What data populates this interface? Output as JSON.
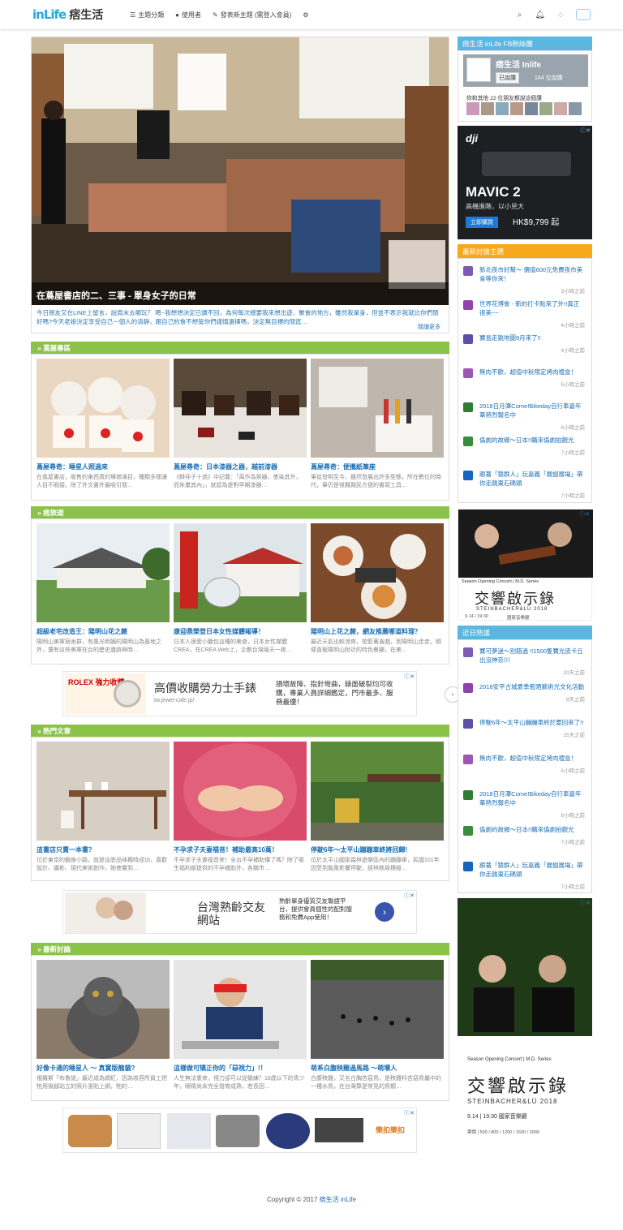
{
  "nav": {
    "logo_mark": "inLife",
    "logo_text": "痞生活",
    "items": [
      "主題分類",
      "使用者",
      "發表新主題 (需登入會員)"
    ]
  },
  "hero": {
    "caption": "在蔦屋書店的二、三事 - 單身女子的日常",
    "excerpt": "今日朋友又在LINE上留言，說周末去哪玩？ 嗯~我想想決定已讀不回，為何每次總要我來想出遊、聚會的地方，雖然我單身，但並不表示我就比你們閒好嗎?今天老娘決定享受自己一個人的清靜，跟自己約會不想管你們謹慎選擇嗎，決定無目標的閒逛…",
    "more": "閱讀更多"
  },
  "sections": [
    {
      "title": "蔦屋專區",
      "cards": [
        {
          "title": "蔦屋尋奇：睡星人照過來",
          "desc": "在蔦屋書店，販售的東西真的琳瑯滿目，種類多樣讓人目不暇接，除了外文書外最吸引我…"
        },
        {
          "title": "蔦屋尋奇：日本漆器之器，越前漆器",
          "desc": "《韓非子十過》中記載：「禹作為祭器，墨染其外，而朱畫其內」，就認為是對早期漆器…"
        },
        {
          "title": "蔦屋尋奇：便攜紙筆座",
          "desc": "筆從發明至今，雖然發展出許多型態，所在數位的時代，筆仍是很難親民方便的書寫工具…"
        }
      ]
    },
    {
      "title": "痞旅遊",
      "cards": [
        {
          "title": "超級老宅改造王：陽明山花之蕨",
          "desc": "陽明山美軍宿舍群，有風光明媚的陽明山為基地之外，還有這些美軍在台的歷史遺跡與時…"
        },
        {
          "title": "康迎鼎榮登日本女性媒體報導！",
          "desc": "日本人很愛小籠包這種的美食，日本女性媒體CREA，在CREA Web上，企劃台灣兩天一夜…"
        },
        {
          "title": "陽明山上花之蕨，網友推薦哪道料理？",
          "desc": "最近天氣出較涼爽，想藍著貪戲，到陽明山走走，順便直衝陽明山附近的特色餐廳，在美…"
        }
      ]
    },
    {
      "title": "熱門文章",
      "cards": [
        {
          "title": "這書店只賣一本書？",
          "desc": "位於東京的銀座小路，就是這麼品味獨特成功，喜歡設計、攝影、現代美術創作，她會嘗到…"
        },
        {
          "title": "不孕求子夫妻福音！補助最高10萬！",
          "desc": "不孕求子夫妻福音來！全台不孕補助懂了嗎？除了衛生福利部提供的不孕補助外，各縣市…"
        },
        {
          "title": "停駛6年～太平山蹦蹦車終將回歸!",
          "desc": "位於太平山國家森林遊樂區內的蹦蹦車，民國101年因受到颱風影響停駛，經林務局積極…"
        }
      ]
    },
    {
      "title": "最新討論",
      "cards": [
        {
          "title": "好像卡通的睡星人 ～ 真實版龍貓?",
          "desc": "俄羅斯「布魯諾」最近成為網紅，因為收容所員工把牠用後腳站立的照片張貼上網，牠的…"
        },
        {
          "title": "這樣做可矯正你的「惡視力」!！",
          "desc": "人生無法重來，視力卻可以從鍛練？18歲以下的青少年，眼睛尚未完全發育成熟，若長因…"
        },
        {
          "title": "萌系白腹秧雞過馬路 ～萌壞人",
          "desc": "白腹秧雞，又名白胸苦惡鳥，是秧雞科苦惡鳥屬中的一種水鳥，在台灣算是常見的鳥類…"
        }
      ]
    }
  ],
  "sidebar": {
    "fb": {
      "title": "痞生活 inLife FB粉絲團",
      "page_name": "痞生活 Inlife",
      "liked": "已說讚",
      "likes": "144 位說讚",
      "friends": "你和其他 22 位朋友都說這個讚"
    },
    "ad_mavic": {
      "brand": "dji",
      "model": "MAVIC 2",
      "tagline": "高機進階，以小見大",
      "cta": "立即購買",
      "price": "HK$9,799 起"
    },
    "latest": {
      "title": "最新討論主題",
      "items": [
        {
          "title": "新北夜市好幫～ 價值600元免費夜市美食等你來！",
          "time": "3小時之前"
        },
        {
          "title": "世界花博會 - 新的打卡點來了外!!真正很美~~",
          "time": "4小時之前"
        },
        {
          "title": "寶島走跳地圖9月來了!!",
          "time": "4小時之前"
        },
        {
          "title": "無肉不歡，超值中秋限定烤肉禮盒！",
          "time": "5小時之前"
        },
        {
          "title": "2018日月潭Come!Bikeday自行車嘉年華熱烈報名中",
          "time": "6小時之前"
        },
        {
          "title": "僞劇的故鄉～日本!!購來僞劇拍觀光",
          "time": "7小時之前"
        },
        {
          "title": "跟著「猿群人」玩嘉義「展翅展場」帶你走跳東石碼頭",
          "time": "7小時之前"
        }
      ]
    },
    "ad_concert": {
      "series": "Season Opening Concert | M.D. Series",
      "title": "交響啟示錄",
      "artists": "STEINBACHER&LÜ 2018",
      "date": "9.14 | 19:30",
      "venue": "國家音樂廳"
    },
    "hot": {
      "title": "近日熱議",
      "items": [
        {
          "title": "寶可夢迷～別錯過 !!1500隻寶光皮卡丘出沒神奈川",
          "time": "20天之前"
        },
        {
          "title": "2018安平古城夏季藍晒藝術光文化活動",
          "time": "8天之前"
        },
        {
          "title": "停駛6年～太平山蹦蹦車終於要回來了!!",
          "time": "15天之前"
        },
        {
          "title": "無肉不歡，超值中秋限定烤肉禮盒！",
          "time": "5小時之前"
        },
        {
          "title": "2018日月潭Come!Bikeday自行車嘉年華熱烈報名中",
          "time": "6小時之前"
        },
        {
          "title": "僞劇的故鄉～日本!!購來僞劇拍觀光",
          "time": "7小時之前"
        },
        {
          "title": "跟著「猿群人」玩嘉義「展翅展場」帶你走跳東石碼頭",
          "time": "7小時之前"
        }
      ]
    },
    "ad_concert2": {
      "series": "Season Opening Concert | M.D. Series",
      "title": "交響啟示錄",
      "artists": "STEINBACHER&LÜ 2018",
      "date": "9.14 | 19:30 國家音樂廳",
      "prices": "票價 | 500 / 800 / 1200 / 1600 / 2000"
    }
  },
  "ads": {
    "rolex": {
      "badge": "ROLEX 強力收購",
      "headline": "高價收購勞力士手錶",
      "url": "tw.jewel-cafe.jp/",
      "body": "損壞故障、指針彎曲，錶面破裂均可收購，專業人員詳細鑑定，門市最多、服務最優！"
    },
    "dating": {
      "headline": "台灣熟齡交友網站",
      "body": "熟齡單身優質交友聯誼平台，提供會員個性的配對服務和免費App使用！"
    },
    "cookware": {
      "label": "樂扣樂扣"
    }
  },
  "footer": {
    "text": "Copyright © 2017",
    "link": "痞生活 inLife"
  },
  "colors": {
    "green": "#8bc34a",
    "blue": "#5bb6e0",
    "orange": "#f7a81b",
    "link": "#1a6fb5"
  }
}
